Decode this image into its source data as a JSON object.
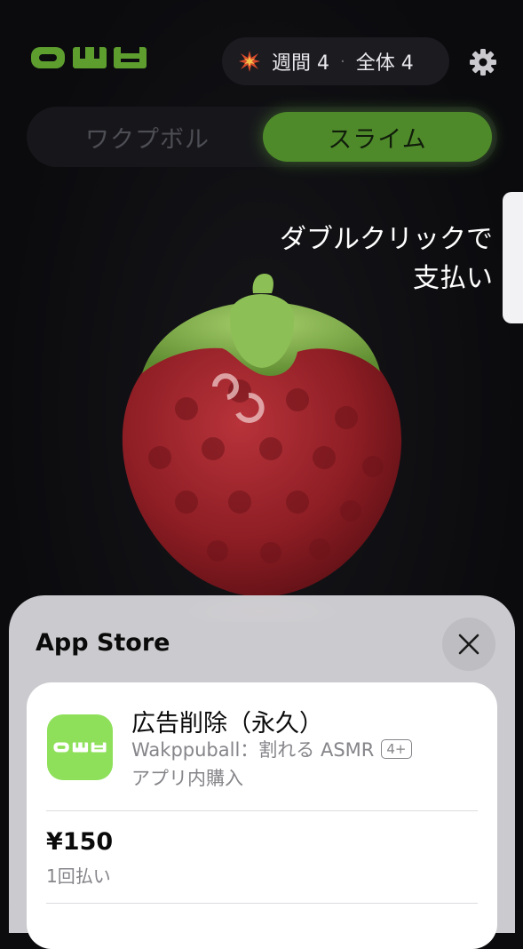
{
  "header": {
    "logo_icon": "owb-logo",
    "stats": {
      "icon": "burst-icon",
      "weekly": "週間 4",
      "separator": "·",
      "total": "全体 4"
    },
    "settings_icon": "gear-icon"
  },
  "tabs": [
    {
      "label": "ワクプボル",
      "active": false
    },
    {
      "label": "スライム",
      "active": true
    }
  ],
  "hint": {
    "line1": "ダブルクリックで",
    "line2": "支払い"
  },
  "sheet": {
    "title": "App Store",
    "close_icon": "close-icon",
    "item_name": "広告削除（永久）",
    "app_name": "Wakppuball：割れる ASMR",
    "age_rating": "4+",
    "item_type": "アプリ内購入",
    "price": "¥150",
    "payment_note": "1回払い"
  },
  "colors": {
    "accent_green": "#4e8a2a",
    "logo_green": "#5e9e2f",
    "app_icon_bg": "#8ee05a",
    "berry_red": "#9b2128",
    "leaf_green": "#7fae49"
  }
}
